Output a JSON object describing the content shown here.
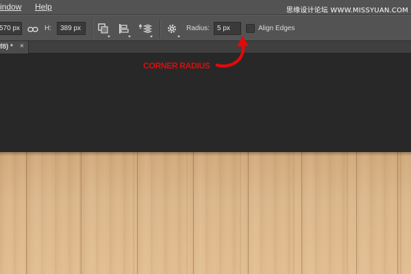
{
  "menubar": {
    "items": [
      {
        "label": "indow"
      },
      {
        "label": "Help"
      }
    ],
    "watermark": "思缘设计论坛 WWW.MISSYUAN.COM"
  },
  "options": {
    "width_value": "570 px",
    "height_label": "H:",
    "height_value": "389 px",
    "radius_label": "Radius:",
    "radius_value": "5 px",
    "align_edges_label": "Align Edges",
    "align_edges_checked": false
  },
  "tab": {
    "label": "f8) *",
    "close": "×"
  },
  "annotation": {
    "text": "CORNER RADIUS",
    "color": "#e10a0a"
  },
  "icons": [
    "link-icon",
    "path-operations-icon",
    "path-alignment-icon",
    "path-arrangement-icon",
    "gear-icon"
  ]
}
